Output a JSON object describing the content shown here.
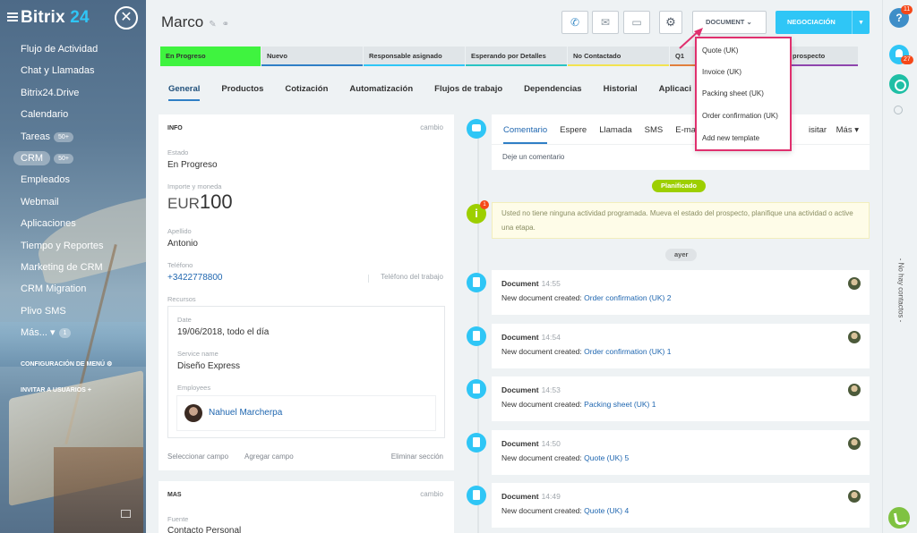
{
  "sidebar": {
    "logo_a": "Bitrix",
    "logo_b": "24",
    "items": [
      {
        "label": "Flujo de Actividad",
        "count": ""
      },
      {
        "label": "Chat y Llamadas",
        "count": ""
      },
      {
        "label": "Bitrix24.Drive",
        "count": ""
      },
      {
        "label": "Calendario",
        "count": ""
      },
      {
        "label": "Tareas",
        "count": "50+"
      },
      {
        "label": "CRM",
        "count": "50+"
      },
      {
        "label": "Empleados",
        "count": ""
      },
      {
        "label": "Webmail",
        "count": ""
      },
      {
        "label": "Aplicaciones",
        "count": ""
      },
      {
        "label": "Tiempo y Reportes",
        "count": ""
      },
      {
        "label": "Marketing de CRM",
        "count": ""
      },
      {
        "label": "CRM Migration",
        "count": ""
      },
      {
        "label": "Plivo SMS",
        "count": ""
      },
      {
        "label": "Más...",
        "count": "1"
      }
    ],
    "config": "CONFIGURACIÓN DE MENÚ",
    "invite": "INVITAR A USUARIOS"
  },
  "header": {
    "title": "Marco",
    "document_button": "DOCUMENT",
    "deal_button": "NEGOCIACIÓN"
  },
  "stages": [
    {
      "label": "En Progreso",
      "color": "#3ff33f"
    },
    {
      "label": "Nuevo",
      "color": "#2f7fc6"
    },
    {
      "label": "Responsable asignado",
      "color": "#2fc6f6"
    },
    {
      "label": "Esperando por Detalles",
      "color": "#29c4c4"
    },
    {
      "label": "No Contactado",
      "color": "#f2e34f"
    },
    {
      "label": "Q1",
      "color": "#e17f3c"
    },
    {
      "label": "r prospecto",
      "color": "#8e44ad"
    }
  ],
  "tabs": [
    "General",
    "Productos",
    "Cotización",
    "Automatización",
    "Flujos de trabajo",
    "Dependencias",
    "Historial",
    "Aplicaci"
  ],
  "info": {
    "section": "INFO",
    "change": "cambio",
    "estado_label": "Estado",
    "estado": "En Progreso",
    "importe_label": "Importe y moneda",
    "currency": "EUR",
    "amount": "100",
    "apellido_label": "Apellido",
    "apellido": "Antonio",
    "telefono_label": "Teléfono",
    "telefono": "+3422778800",
    "telefono_type": "Teléfono del trabajo",
    "recursos_label": "Recursos",
    "date_label": "Date",
    "date": "19/06/2018, todo el día",
    "service_label": "Service name",
    "service": "Diseño Express",
    "employees_label": "Employees",
    "employee": "Nahuel Marcherpa",
    "select_field": "Seleccionar campo",
    "add_field": "Agregar campo",
    "delete_section": "Eliminar sección"
  },
  "mas": {
    "section": "MAS",
    "change": "cambio",
    "fuente_label": "Fuente",
    "fuente": "Contacto Personal"
  },
  "composer": {
    "tabs": [
      "Comentario",
      "Espere",
      "Llamada",
      "SMS",
      "E-ma",
      "isitar"
    ],
    "more": "Más",
    "placeholder": "Deje un comentario"
  },
  "timeline": {
    "planned": "Planificado",
    "warning_badge": "1",
    "warning": "Usted no tiene ninguna actividad programada. Mueva el estado del prospecto, planifique una actividad o active una etapa.",
    "yesterday": "ayer",
    "created_prefix": "New document created:",
    "docs": [
      {
        "title": "Document",
        "time": "14:55",
        "link": "Order confirmation (UK) 2"
      },
      {
        "title": "Document",
        "time": "14:54",
        "link": "Order confirmation (UK) 1"
      },
      {
        "title": "Document",
        "time": "14:53",
        "link": "Packing sheet (UK) 1"
      },
      {
        "title": "Document",
        "time": "14:50",
        "link": "Quote (UK) 5"
      },
      {
        "title": "Document",
        "time": "14:49",
        "link": "Quote (UK) 4"
      }
    ]
  },
  "dropdown": [
    "Quote (UK)",
    "Invoice (UK)",
    "Packing sheet (UK)",
    "Order confirmation (UK)",
    "Add new template"
  ],
  "rightbar": {
    "help_badge": "11",
    "notif_badge": "27",
    "no_contacts": "- No hay contactos -"
  },
  "colors": {
    "accent": "#2fc6f6",
    "highlight": "#e0306e",
    "stage_active": "#3ff33f"
  }
}
